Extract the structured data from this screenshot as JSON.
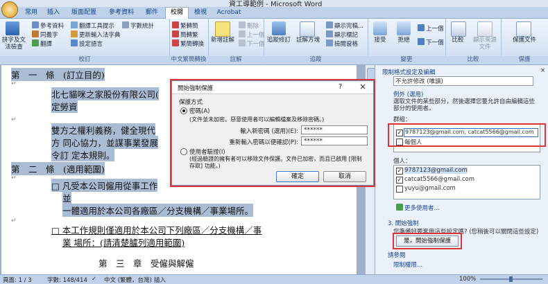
{
  "window": {
    "title": "資工導範例 - Microsoft Word"
  },
  "tabs": [
    "常用",
    "插入",
    "版面配置",
    "參考資料",
    "郵件",
    "校閱",
    "檢視",
    "Acrobat"
  ],
  "ribbon": {
    "proofing": {
      "label": "校訂",
      "spelling": "拼字及文法檢查",
      "research": "參考資料",
      "thesaurus": "同義字",
      "translate": "翻譯",
      "translate_tip": "翻譯工具提示",
      "language": "設定語言",
      "word_count": "字數統計",
      "new_dict": "更新輸入法字典"
    },
    "chinese": {
      "label": "中文繁簡轉換",
      "to_trad": "繁轉簡",
      "to_simp": "簡轉繁",
      "convert": "繁簡轉換"
    },
    "comments": {
      "label": "註解",
      "new": "新增註解",
      "delete": "刪除",
      "prev": "上一個",
      "next": "下一個"
    },
    "tracking": {
      "label": "追蹤",
      "track": "追蹤修訂",
      "balloons": "註解方塊",
      "display": "顯示完稿...",
      "show_markup": "顯示標記",
      "review_pane": "檢閱窗格"
    },
    "changes": {
      "label": "變更",
      "accept": "接受",
      "reject": "拒絕",
      "prev": "上一個",
      "next": "下一個"
    },
    "compare": {
      "label": "比較",
      "compare": "比較",
      "show_source": "顯示來源文件"
    },
    "protect": {
      "label": "保護",
      "protect_doc": "保護文件"
    }
  },
  "document": {
    "lines": [
      "第　一　條　(訂立目的)",
      "北七貓咪之家股份有限公司(",
      "定勞資",
      "雙方之權利義務，健全現代",
      "方 同心協力，並謀事業發展",
      "令訂 定本規則。",
      "第　二　條　(適用範圍)",
      "□ 凡受本公司僱用從事工作",
      "並",
      "一體適用於本公司各廠區／分支機構／事業場所。",
      "□ 本工作規則僅適用於本公司下列廠區／分支機構／事",
      "業 場所：(請清楚臚列適用範圍)",
      "第　三　章　受僱與解僱"
    ]
  },
  "pane": {
    "header": "限制格式設定及編輯",
    "editing_mode": "不允許修改 (唯讀)",
    "exceptions_title": "例外 (選用)",
    "exceptions_desc": "選取文件的某些部分，然後選擇您要允許自由編輯這些部分的使用者。",
    "groups_label": "群組：",
    "groups_value": "9787123@gmail.com, catcat5566@gmail.com",
    "everyone": "每個人",
    "users_label": "個人：",
    "users": [
      "9787123@gmail.com",
      "catcat5566@gmail.com",
      "yuyu@gmail.com"
    ],
    "more_users": "更多使用者...",
    "step3_title": "3. 開始強制",
    "step3_desc": "您準備好要套用這些設定嗎? (您稍後可以關閉這些設定)",
    "start_button": "是，開始強制保護",
    "see_also": "請參閱",
    "perm_link": "限制權限..."
  },
  "dialog": {
    "title": "開始強制保護",
    "help": "?",
    "section": "保護方式",
    "password_option": "密碼(A)",
    "password_note": "(文件並未加密。惡意使用者可以編輯檔案及移除密碼。)",
    "new_pwd_label": "輸入新密碼 (選用)(E):",
    "new_pwd_value": "******",
    "confirm_pwd_label": "重新輸入密碼以便確認(P):",
    "confirm_pwd_value": "******",
    "user_auth_option": "使用者驗證(I)",
    "user_auth_note": "(經過驗證的擁有者可以移除文件保護。文件已加密，而且已啟用 [限制存取] 功能。)",
    "ok": "確定",
    "cancel": "取消"
  },
  "status": {
    "page": "頁面: 1 / 3",
    "words": "字數: 148/414",
    "language": "中文 (繁體，台灣)",
    "mode": "插入",
    "zoom": "100%"
  },
  "colors": {
    "accent": "#15428b",
    "highlight": "#e03333",
    "selection": "#a9bcd4"
  }
}
